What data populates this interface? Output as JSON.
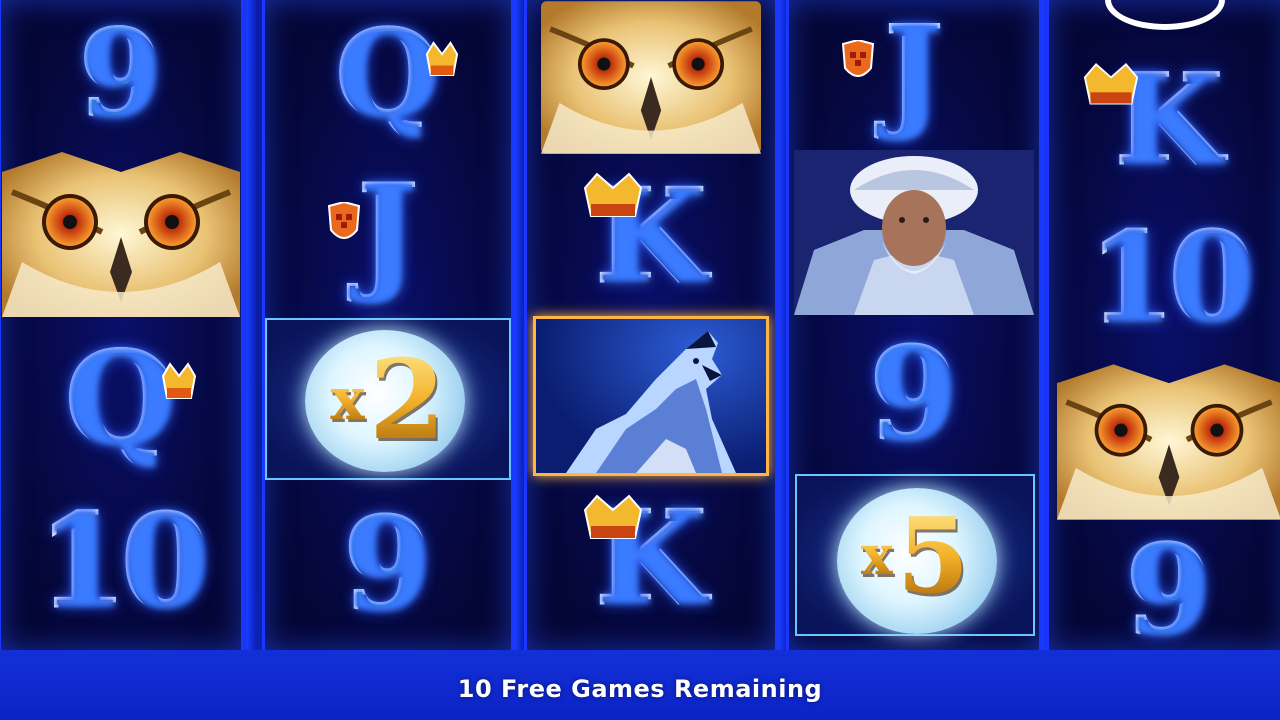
{
  "game": {
    "status_text": "10 Free Games Remaining"
  },
  "reels": [
    {
      "name": "reel-1",
      "symbols": [
        "9",
        "owl",
        "Q",
        "10"
      ]
    },
    {
      "name": "reel-2",
      "symbols": [
        "Q",
        "J",
        "x2",
        "9"
      ]
    },
    {
      "name": "reel-3",
      "symbols": [
        "owl",
        "K",
        "wolf",
        "K"
      ]
    },
    {
      "name": "reel-4",
      "symbols": [
        "J",
        "trapper",
        "9",
        "x5"
      ]
    },
    {
      "name": "reel-5",
      "symbols": [
        "K",
        "10",
        "owl",
        "9"
      ]
    }
  ],
  "labels": {
    "nine": "9",
    "ten": "10",
    "queen": "Q",
    "jack": "J",
    "king": "K",
    "x": "x",
    "mult2": "2",
    "mult5": "5"
  },
  "colors": {
    "nine": "#1ea82a",
    "ten": "#e8421a",
    "queen": "#f1b42a",
    "jack": "#1b3bd6",
    "king": "#e8421a",
    "wolf_frame": "#ffb546",
    "moon_frame": "#68c7ff"
  },
  "icons": [
    "owl-icon",
    "wolf-icon",
    "trapper-icon",
    "moon-icon",
    "crown-icon",
    "shield-icon"
  ]
}
